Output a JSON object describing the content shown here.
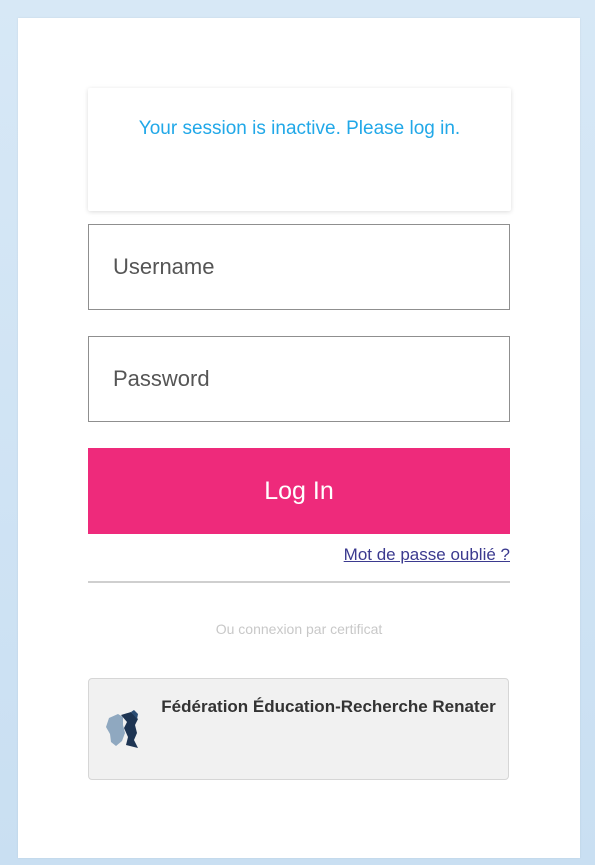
{
  "notice": {
    "message": "Your session is inactive. Please log in."
  },
  "form": {
    "username_placeholder": "Username",
    "password_placeholder": "Password",
    "login_label": "Log In",
    "forgot_password_label": "Mot de passe oublié ?"
  },
  "certificate": {
    "label": "Ou connexion par certificat",
    "provider_label": "Fédération Éducation-Recherche Renater",
    "provider_icon": "france-map-icon"
  },
  "colors": {
    "accent": "#ee2a7b",
    "notice_text": "#21a8e8",
    "link": "#3b3a8f"
  }
}
